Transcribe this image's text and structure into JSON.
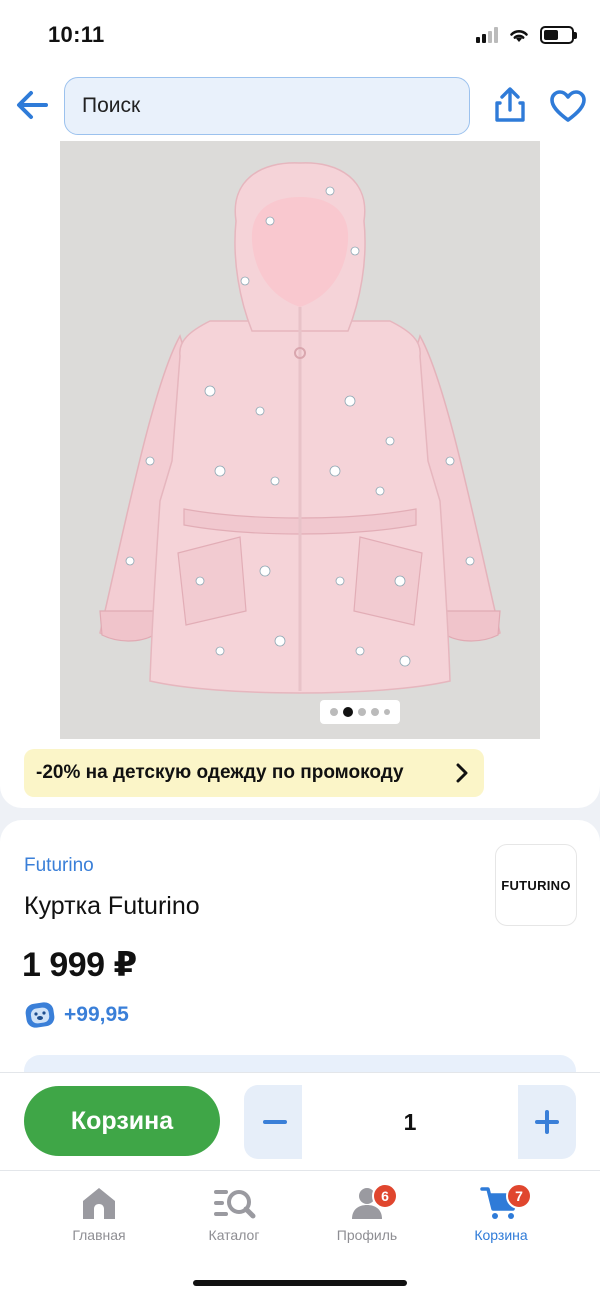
{
  "status_bar": {
    "time": "10:11"
  },
  "header": {
    "search_placeholder": "Поиск"
  },
  "gallery": {
    "image_count": 5,
    "active_index": 1
  },
  "promo": {
    "text": "-20% на детскую одежду по промокоду"
  },
  "product": {
    "brand": "Futurino",
    "brand_logo_text": "FUTURINO",
    "title": "Куртка Futurino",
    "price": "1 999 ₽",
    "bonus": "+99,95"
  },
  "action_bar": {
    "cart_label": "Корзина",
    "quantity": "1"
  },
  "tabs": [
    {
      "label": "Главная",
      "icon": "home-icon"
    },
    {
      "label": "Каталог",
      "icon": "catalog-search-icon"
    },
    {
      "label": "Профиль",
      "icon": "profile-icon",
      "badge": "6"
    },
    {
      "label": "Корзина",
      "icon": "cart-icon",
      "badge": "7",
      "active": true
    }
  ],
  "colors": {
    "accent": "#3a7fd8",
    "cart_button": "#3fa647",
    "promo_bg": "#fbf5c8",
    "badge": "#e0462e"
  }
}
